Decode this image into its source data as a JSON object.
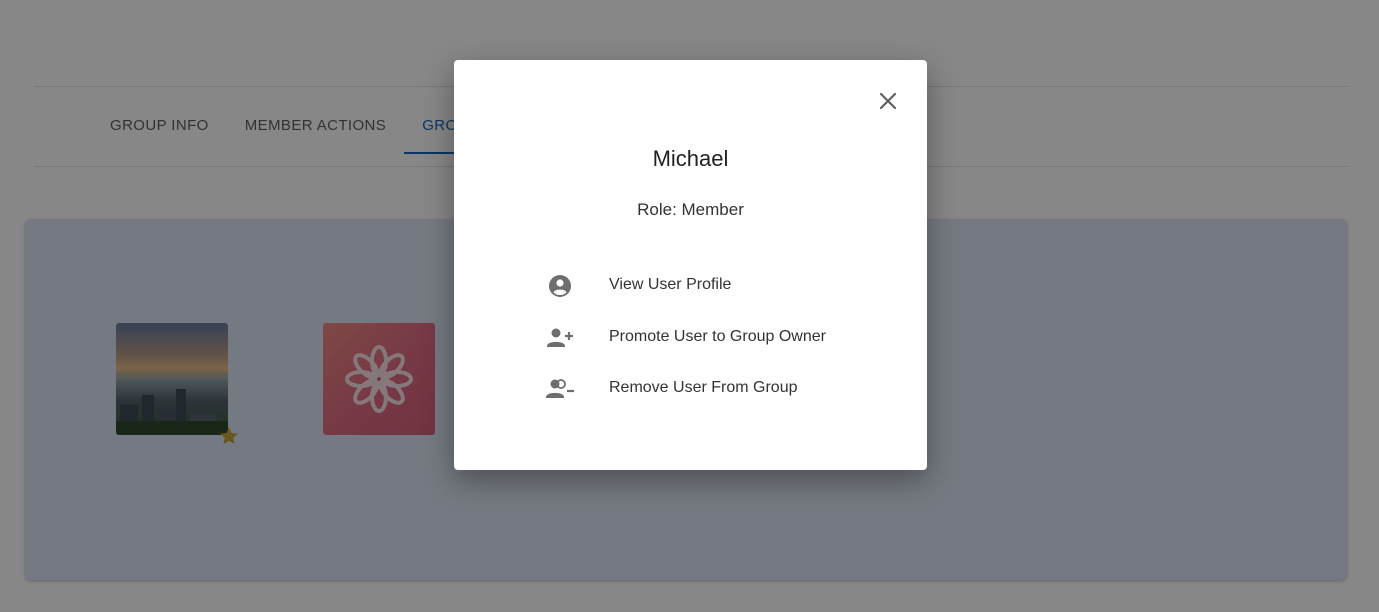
{
  "tabs": [
    {
      "label": "GROUP INFO"
    },
    {
      "label": "MEMBER ACTIONS"
    },
    {
      "label": "GROUP MEMBERS"
    }
  ],
  "members": [
    {
      "image": "city-skyline-photo",
      "is_owner": true
    },
    {
      "image": "flower-icon-avatar",
      "is_owner": false
    }
  ],
  "dialog": {
    "name": "Michael",
    "role": "Role: Member",
    "actions": [
      {
        "label": "View User Profile",
        "icon": "account-circle-icon"
      },
      {
        "label": "Promote User to Group Owner",
        "icon": "person-add-icon"
      },
      {
        "label": "Remove User From Group",
        "icon": "person-remove-icon"
      }
    ]
  },
  "colors": {
    "accent": "#1565c0",
    "panel": "#dde4f4",
    "owner_star": "#c9a43a",
    "icon_gray": "#6e6e6e"
  }
}
